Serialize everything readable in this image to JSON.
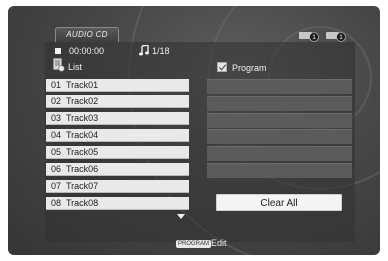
{
  "header": {
    "tab_label": "AUDIO CD",
    "elapsed_time": "00:00:00",
    "track_counter": "1/18"
  },
  "list_panel": {
    "title": "List",
    "tracks": [
      {
        "num": "01",
        "name": "Track01"
      },
      {
        "num": "02",
        "name": "Track02"
      },
      {
        "num": "03",
        "name": "Track03"
      },
      {
        "num": "04",
        "name": "Track04"
      },
      {
        "num": "05",
        "name": "Track05"
      },
      {
        "num": "06",
        "name": "Track06"
      },
      {
        "num": "07",
        "name": "Track07"
      },
      {
        "num": "08",
        "name": "Track08"
      }
    ]
  },
  "program_panel": {
    "title": "Program",
    "slots": [
      "",
      "",
      "",
      "",
      "",
      ""
    ],
    "clear_all_label": "Clear All"
  },
  "footer": {
    "button_badge": "PROGRAM",
    "action_label": "Edit"
  },
  "icons": {
    "playback_status": "stop-icon",
    "music": "music-note-icon",
    "list": "list-icon",
    "more_below": "scroll-down-arrow-icon"
  },
  "colors": {
    "background": "#474747",
    "list_row": "#e9e9e9",
    "program_slot": "#5b5b5b",
    "text_light": "#f0f0f0",
    "text_dark": "#222222"
  }
}
